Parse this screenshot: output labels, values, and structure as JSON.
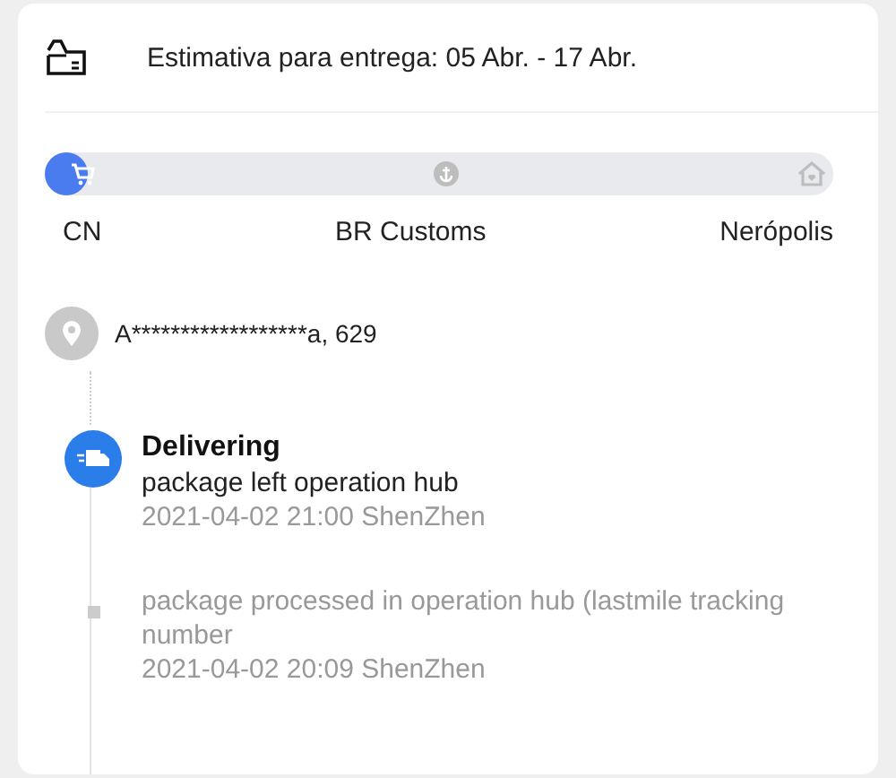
{
  "estimate": {
    "text": "Estimativa para entrega: 05 Abr. - 17 Abr."
  },
  "progress": {
    "level": 0.04,
    "stages": [
      {
        "label": "CN",
        "kind": "origin",
        "reached": true
      },
      {
        "label": "BR Customs",
        "kind": "customs",
        "reached": false
      },
      {
        "label": "Nerópolis",
        "kind": "destination",
        "reached": false
      }
    ]
  },
  "address": {
    "text": "A******************a,  629"
  },
  "events": [
    {
      "kind": "current",
      "title": "Delivering",
      "detail": "package left operation hub",
      "time": "2021-04-02 21:00 ShenZhen"
    },
    {
      "kind": "past",
      "detail": "package processed in operation hub (lastmile tracking number",
      "time": "2021-04-02 20:09 ShenZhen"
    }
  ]
}
